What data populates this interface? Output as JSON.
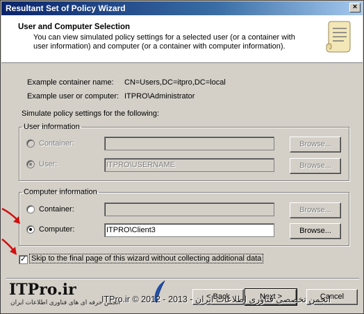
{
  "window": {
    "title": "Resultant Set of Policy Wizard",
    "close_glyph": "×"
  },
  "header": {
    "title": "User and Computer Selection",
    "description": "You can view simulated policy settings for a selected user (or a container with user information) and computer (or a container with computer information).",
    "icon": "scroll-icon"
  },
  "examples": [
    {
      "label": "Example container name:",
      "value": "CN=Users,DC=itpro,DC=local"
    },
    {
      "label": "Example user or computer:",
      "value": "ITPRO\\Administrator"
    }
  ],
  "prompt": "Simulate policy settings for the following:",
  "user_info": {
    "legend": "User information",
    "container_label": "Container:",
    "container_value": "",
    "user_label": "User:",
    "user_value": "ITPRO\\USERNAME",
    "selected": "user",
    "enabled": false,
    "browse_label": "Browse..."
  },
  "computer_info": {
    "legend": "Computer information",
    "container_label": "Container:",
    "container_value": "",
    "computer_label": "Computer:",
    "computer_value": "ITPRO\\Client3",
    "selected": "computer",
    "browse_label": "Browse..."
  },
  "skip_checkbox": {
    "label": "Skip to the final page of this wizard without collecting additional data",
    "checked": true,
    "check_glyph": "✓"
  },
  "footer": {
    "back_label": "< Back",
    "next_label": "Next >",
    "cancel_label": "Cancel"
  },
  "branding": {
    "logo": "ITPro.ir",
    "logo_sub": "انجمن حرفه ای های فناوری اطلاعات ایران",
    "watermark": "انجمن تخصصی فناوری اطلاعات ایران - 2013 - 2012 © ITPro.ir"
  },
  "colors": {
    "annotation_arrow": "#d01010",
    "title_bar": "#0a246a"
  }
}
